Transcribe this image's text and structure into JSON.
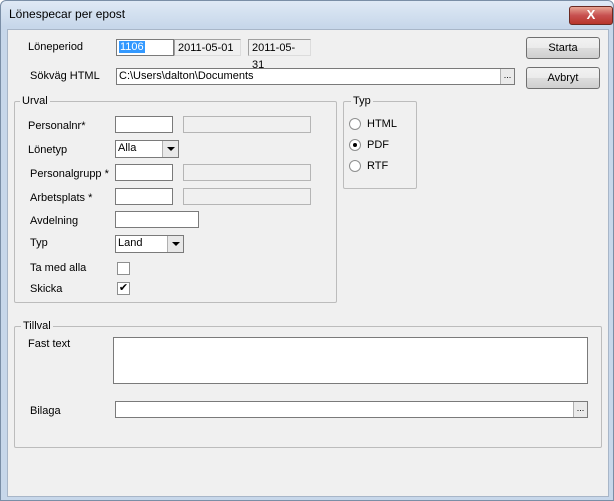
{
  "window": {
    "title": "Lönespecar per epost",
    "close_glyph": "X"
  },
  "buttons": {
    "start": "Starta",
    "cancel": "Avbryt"
  },
  "period": {
    "label": "Löneperiod",
    "code": "1106",
    "from": "2011-05-01",
    "to": "2011-05-31"
  },
  "path": {
    "label": "Sökväg HTML",
    "value": "C:\\Users\\dalton\\Documents",
    "browse": "..."
  },
  "urval": {
    "title": "Urval",
    "personalnr_label": "Personalnr*",
    "lonetyp_label": "Lönetyp",
    "lonetyp_value": "Alla",
    "personalgrupp_label": "Personalgrupp *",
    "arbetsplats_label": "Arbetsplats *",
    "avdelning_label": "Avdelning",
    "typ_label": "Typ",
    "typ_value": "Land",
    "tamedalla_label": "Ta med alla",
    "skicka_label": "Skicka",
    "skicka_mark": "✔"
  },
  "typ": {
    "title": "Typ",
    "options": [
      "HTML",
      "PDF",
      "RTF"
    ],
    "selected": "PDF"
  },
  "tillval": {
    "title": "Tillval",
    "fasttext_label": "Fast text",
    "bilaga_label": "Bilaga",
    "browse": "..."
  }
}
